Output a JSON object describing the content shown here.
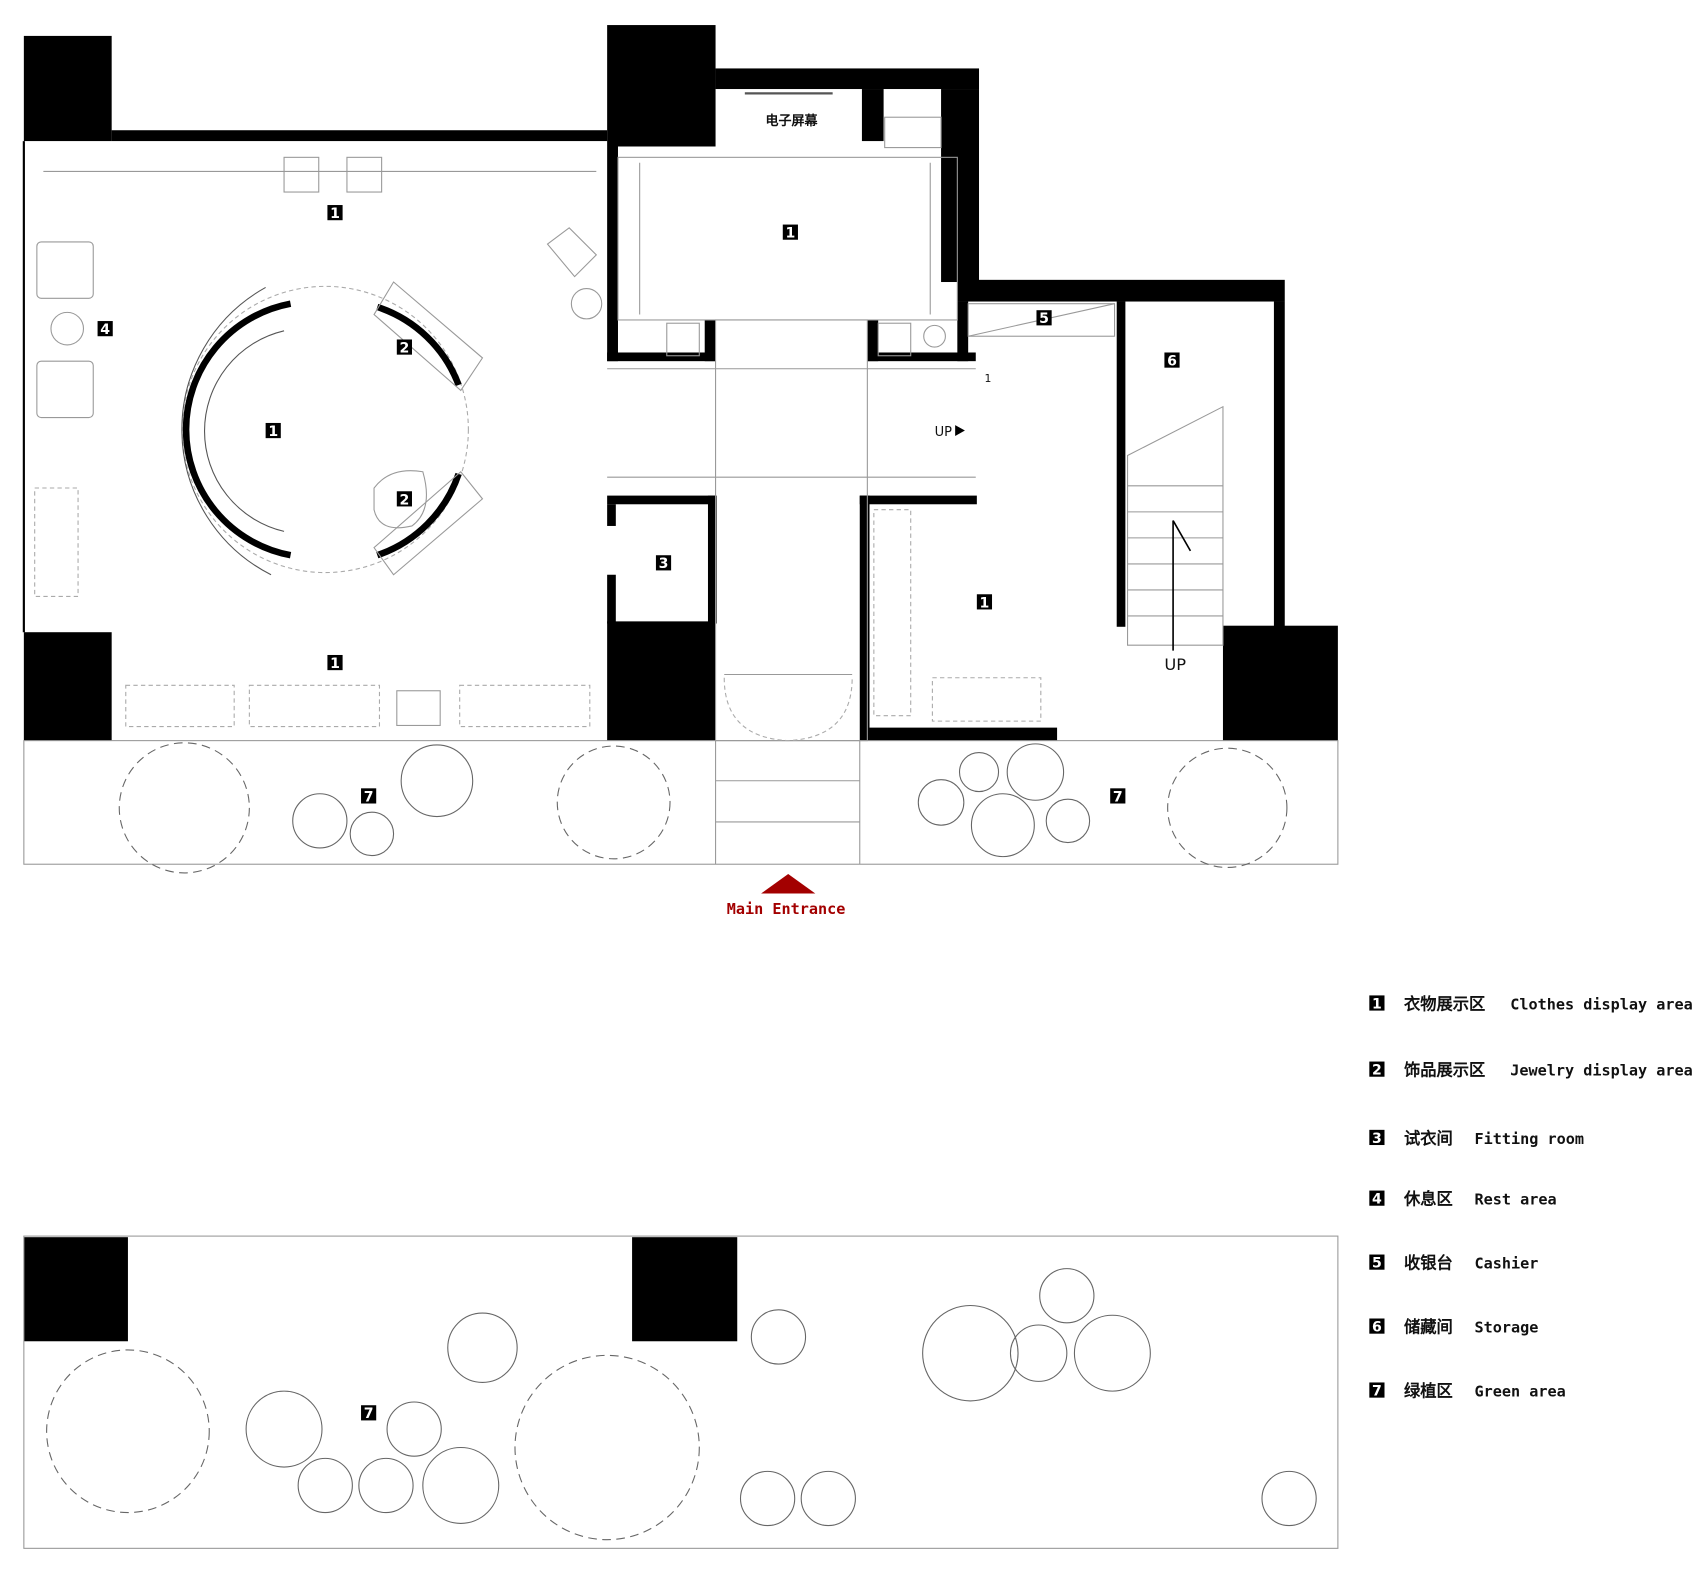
{
  "plan": {
    "screen_label": "电子屏幕",
    "up_label_corridor": "UP",
    "up_label_stairs": "UP",
    "step_marker": "1",
    "entrance_label": "Main Entrance",
    "entrance_color": "#a30000",
    "area_markers": [
      "1",
      "1",
      "1",
      "1",
      "1",
      "2",
      "2",
      "3",
      "4",
      "5",
      "6",
      "7",
      "7",
      "7"
    ]
  },
  "legend": {
    "items": [
      {
        "num": "1",
        "zh": "衣物展示区",
        "en": "Clothes display area"
      },
      {
        "num": "2",
        "zh": "饰品展示区",
        "en": "Jewelry display area"
      },
      {
        "num": "3",
        "zh": "试衣间",
        "en": "Fitting room"
      },
      {
        "num": "4",
        "zh": "休息区",
        "en": "Rest area"
      },
      {
        "num": "5",
        "zh": "收银台",
        "en": "Cashier"
      },
      {
        "num": "6",
        "zh": "储藏间",
        "en": "Storage"
      },
      {
        "num": "7",
        "zh": "绿植区",
        "en": "Green area"
      }
    ]
  }
}
